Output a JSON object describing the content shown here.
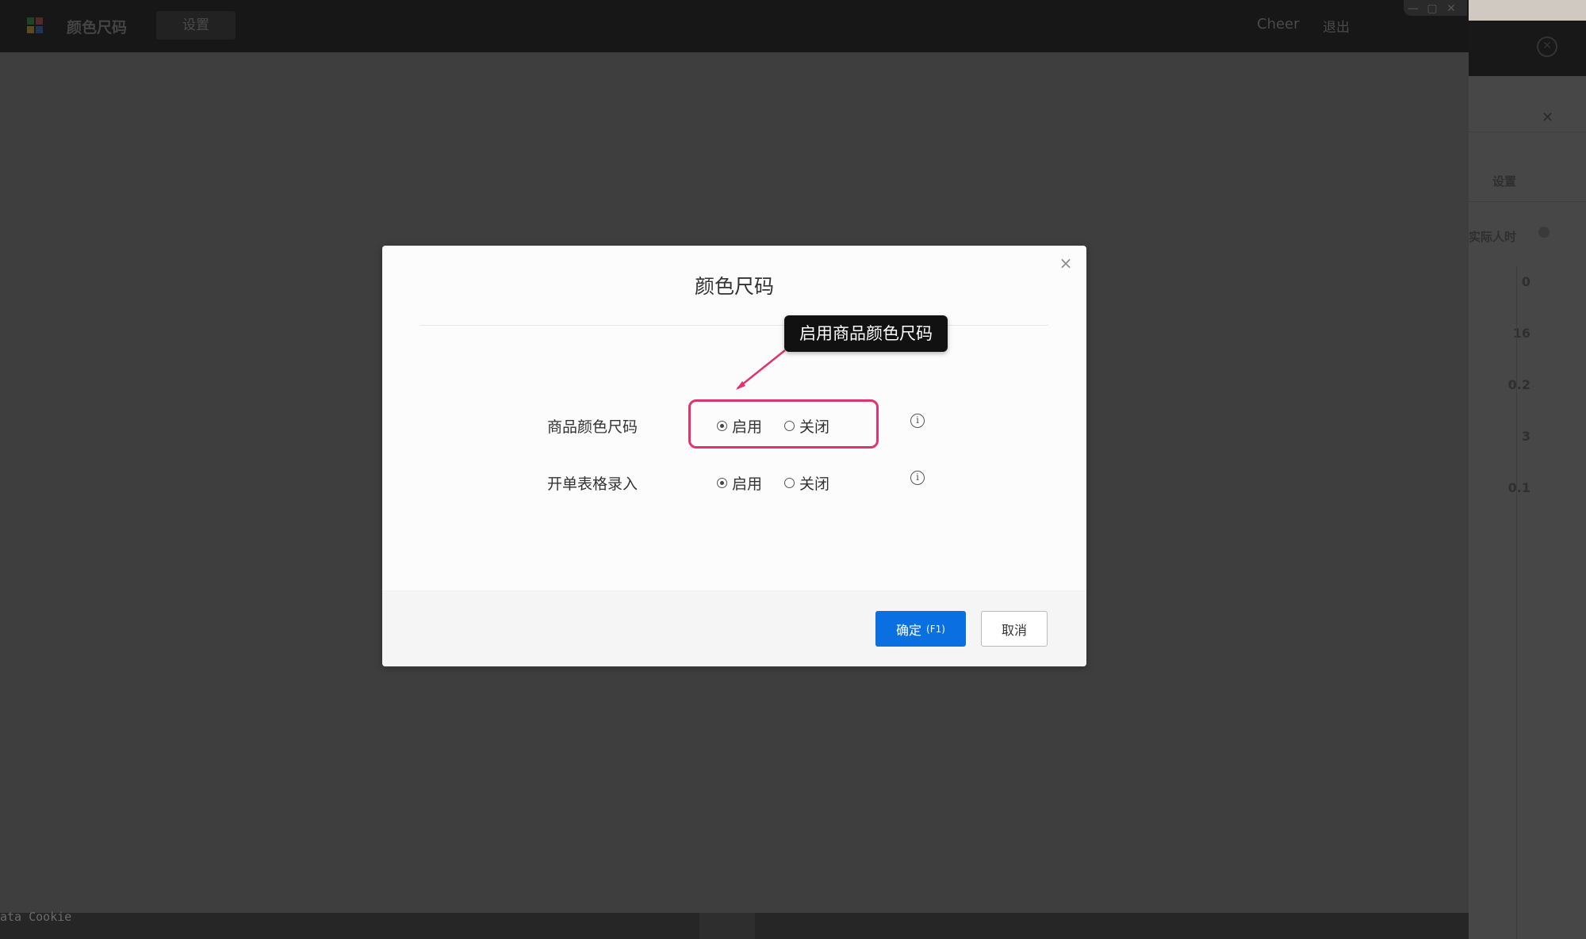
{
  "app": {
    "title": "颜色尺码",
    "tab_label": "设置",
    "user_name": "Cheer",
    "logout_label": "退出",
    "window_controls": [
      "—",
      "▢",
      "✕"
    ],
    "status_text": "ata Cookie"
  },
  "right_pane": {
    "close_icon": "✕",
    "settings_label": "设置",
    "column_label": "实际人时",
    "values": [
      "0",
      "16",
      "0.2",
      "3",
      "0.1"
    ]
  },
  "dialog": {
    "title": "颜色尺码",
    "close_label": "×",
    "rows": [
      {
        "label": "商品颜色尺码",
        "option_enable": "启用",
        "option_disable": "关闭",
        "selected": "启用",
        "info_icon": "i"
      },
      {
        "label": "开单表格录入",
        "option_enable": "启用",
        "option_disable": "关闭",
        "selected": "启用",
        "info_icon": "i"
      }
    ],
    "ok_label": "确定",
    "ok_shortcut": "(F1)",
    "cancel_label": "取消"
  },
  "annotation": {
    "tooltip": "启用商品颜色尺码",
    "highlight_color": "#e0336f"
  },
  "colors": {
    "primary": "#0a6fe0",
    "overlay": "#3e3e3e"
  }
}
